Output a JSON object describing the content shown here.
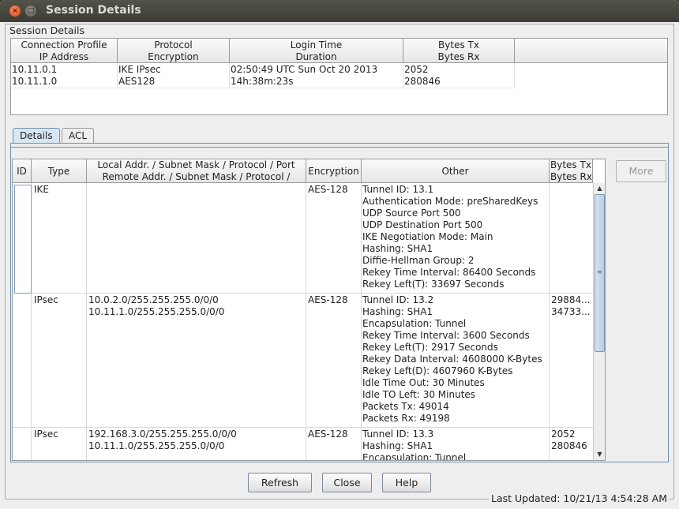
{
  "window": {
    "title": "Session Details"
  },
  "group": {
    "legend": "Session Details"
  },
  "session": {
    "headers": [
      [
        "Connection Profile",
        "IP Address"
      ],
      [
        "Protocol",
        "Encryption"
      ],
      [
        "Login Time",
        "Duration"
      ],
      [
        "Bytes Tx",
        "Bytes Rx"
      ]
    ],
    "row": [
      [
        "10.11.0.1",
        "10.11.1.0"
      ],
      [
        "IKE IPsec",
        "AES128"
      ],
      [
        "02:50:49 UTC Sun Oct 20 2013",
        "14h:38m:23s"
      ],
      [
        "2052",
        "280846"
      ]
    ]
  },
  "tabs": {
    "details": "Details",
    "acl": "ACL"
  },
  "details": {
    "headers": {
      "id": "ID",
      "type": "Type",
      "addr1": "Local Addr. / Subnet Mask / Protocol / Port",
      "addr2": "Remote Addr. / Subnet Mask / Protocol /",
      "encryption": "Encryption",
      "other": "Other",
      "bytes1": "Bytes Tx",
      "bytes2": "Bytes Rx"
    },
    "rows": [
      {
        "type": "IKE",
        "addr": "",
        "encryption": "AES-128",
        "other": "Tunnel ID: 13.1\nAuthentication Mode: preSharedKeys\nUDP Source Port 500\nUDP Destination Port 500\nIKE Negotiation Mode: Main\nHashing: SHA1\nDiffie-Hellman Group: 2\nRekey Time Interval: 86400 Seconds\nRekey Left(T): 33697 Seconds",
        "bytes": ""
      },
      {
        "type": "IPsec",
        "addr": "10.0.2.0/255.255.255.0/0/0\n10.11.1.0/255.255.255.0/0/0",
        "encryption": "AES-128",
        "other": "Tunnel ID: 13.2\nHashing: SHA1\nEncapsulation: Tunnel\nRekey Time Interval: 3600 Seconds\nRekey Left(T): 2917 Seconds\nRekey Data Interval: 4608000 K-Bytes\nRekey Left(D): 4607960 K-Bytes\nIdle Time Out: 30 Minutes\nIdle TO Left: 30 Minutes\nPackets Tx: 49014\nPackets Rx: 49198",
        "bytes": "29884...\n34733..."
      },
      {
        "type": "IPsec",
        "addr": "192.168.3.0/255.255.255.0/0/0\n10.11.1.0/255.255.255.0/0/0",
        "encryption": "AES-128",
        "other": "Tunnel ID: 13.3\nHashing: SHA1\nEncapsulation: Tunnel",
        "bytes": "2052\n280846"
      }
    ],
    "more_label": "More"
  },
  "buttons": {
    "refresh": "Refresh",
    "close": "Close",
    "help": "Help"
  },
  "status": {
    "last_updated": "Last Updated: 10/21/13 4:54:28 AM"
  },
  "icons": {
    "close": "close-icon",
    "maximize": "maximize-icon"
  }
}
